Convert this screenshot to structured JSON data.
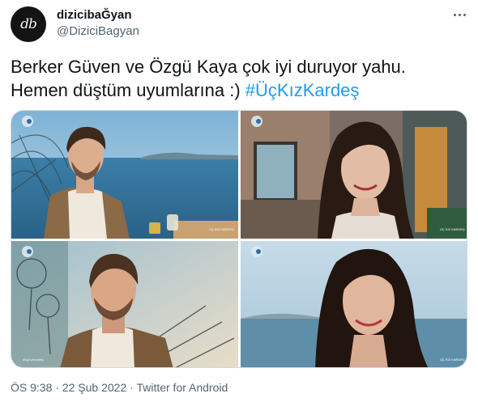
{
  "author": {
    "display_name": "dizicibaĞyan",
    "handle": "@DiziciBagyan",
    "avatar_text": "db"
  },
  "tweet": {
    "text": "Berker Güven ve Özgü Kaya çok iyi duruyor yahu. Hemen düştüm uyumlarına :)",
    "hashtag": "#ÜçKızKardeş"
  },
  "media": {
    "images": [
      {
        "description": "Man in cream turtleneck and brown jacket seated by the sea",
        "watermark": "ÜÇ KIZ KARDEŞ"
      },
      {
        "description": "Woman with long dark wavy hair smiling, house in background",
        "watermark": "ÜÇ KIZ KARDEŞ"
      },
      {
        "description": "Close-up of man in turtleneck with dreamcatchers behind",
        "watermark": "#ÜçKızKardeş"
      },
      {
        "description": "Woman with dark hair smiling by the sea",
        "watermark": "ÜÇ KIZ KARDEŞ"
      }
    ]
  },
  "meta": {
    "time": "ÖS 9:38",
    "separator": " · ",
    "date": "22 Şub 2022",
    "source": "Twitter for Android"
  },
  "colors": {
    "accent": "#1d9bf0",
    "text": "#0f1419",
    "secondary": "#536471"
  }
}
